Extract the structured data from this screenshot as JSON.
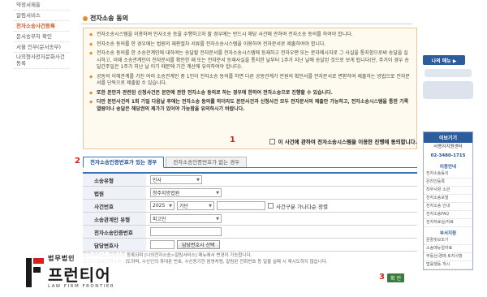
{
  "sidebar": {
    "items": [
      {
        "label": "약정서제출"
      },
      {
        "label": "알림서비스"
      },
      {
        "label": "전자소송사건등록",
        "active": true
      },
      {
        "label": "문서송부처 확인"
      },
      {
        "label": "서울 인부(문서송부)"
      },
      {
        "label": "나의형사전자문화사건등록"
      }
    ]
  },
  "main": {
    "title": "전자소송 동의",
    "notices": [
      "전자소송시스템을 이용하여 민사소송 등을 수행하고자 할 경우에는 반드시 해당 사건에 관하여 전자소송 동의를 하여야 합니다.",
      "전자소송 동의를 한 경우에는 법원의 재판절차 서류를 전자소송시스템을 이용하여 전자문서로 제출하여야 합니다.",
      "전자소송 동의를 한 소송관계인에 대하여는 송달할 전자문서를 전자소송시스템에 등재하고 전자우편 또는 문자메시지로 그 사실을 통지함으로써 송달을 실시하고, 이때 소송관계인이 전자문서를 확인한 때 또는 전자문서 등재사실을 통지한 날부터 1주가 지난 날에 송달된 것으로 보게 됩니다(단, 주거이 경우 송달간주일은 1주가 지난 날 이기 때문에 기간 계산에 유의하여야 합니다).",
      "공동의 이해관계를 가진 여러 소송관계인 중 1인이 전자소송 동의를 하면 다른 공동관계가 전원의 확인서를 전자문서로 변환하여 제출하는 방법으로 전자문서를 단독으로 제출할 수 있습니다.",
      "또한 본안과 관련된 신청사건은 본안에 관한 전자소송 동의로 하는 경우에 한하여 전자소송으로 진행할 수 있습니다.",
      "다만 본안사건의 1회 기일 다음날 후에는 전자소송 동의를 하더라도 본안사건과 신청사건 모두 전자문서의 제출만 가능하고, 전자소송시스템을 통한 기록열람이나 송달은 해당권의 제가가 있어야 가능함을 유의하시기 바랍니다."
    ],
    "agree_label": "이 사건에 관하여 전자소송시스템을 이용한 진행에 동의합니다.",
    "tabs": [
      "전자소송인증번호가 있는 경우",
      "전자소송인증번호가 없는 경우"
    ],
    "form": {
      "case_type_label": "소송유형",
      "case_type_value": "민사",
      "court_label": "법원",
      "court_value": "청주지방법원",
      "case_no_label": "사건번호",
      "year_value": "2025",
      "case_kind_value": "가단",
      "sibling_label": "사건구분 가나다순 정렬",
      "relation_label": "소송관계인 유형",
      "relation_value": "피고인",
      "auth_label": "전자소송인증번호",
      "lawyer_label": "담당변호사",
      "lawyer_button": "담당변호사 선택"
    },
    "footnotes": [
      "알림서비스는 자동으로 등록되며 [나의전자소송>알림서비스] 메뉴에서 변경이 가능합니다.",
      "조회가 완료되면 1회 시도하며, 수신인의 휴대폰 번호, 수신동기한 음영처럼, 알림된 전화번호 등 일을 실패 시 재시도하지 않습니다."
    ],
    "ok_label": "확 인"
  },
  "markers": [
    "1",
    "2",
    "3"
  ],
  "right": {
    "menu_label": "나의 메뉴 ▶",
    "card_title": "이보기기",
    "card_line1": "사용자지원센터",
    "card_line2": "02-3480-1715",
    "section1": "이용안내",
    "links1": [
      "전자소송동의",
      "온라인등록",
      "직무사항 소관",
      "전자소송포털",
      "전자소송 안내",
      "전자소송FAQ",
      "전자자료실/자료"
    ],
    "section2": "부서지원",
    "links2": [
      "문활및보조기",
      "소송매뉴얼자료",
      "부동산/경매 토지사항",
      "법률행동 개시"
    ]
  },
  "logo": {
    "sub": "법무법인",
    "main": "프런티어",
    "en": "LAW FIRM FRONTIER"
  },
  "colors": {
    "accent_orange": "#e68a2e",
    "primary_blue": "#2c5c9c",
    "marker_red": "#d21f1f",
    "ok_green": "#3a7d3a"
  }
}
